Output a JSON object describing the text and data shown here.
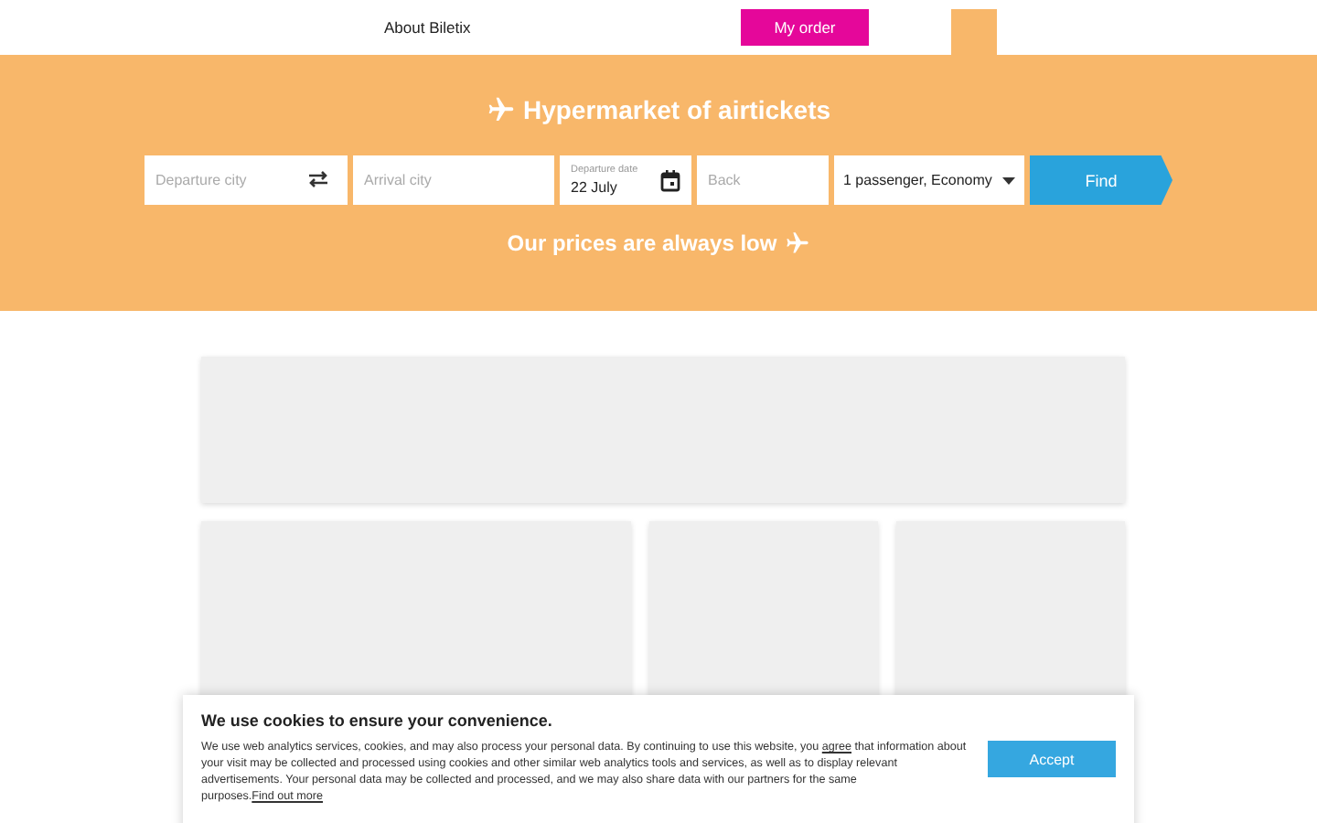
{
  "header": {
    "nav_link": "About Biletix",
    "order_button": "My order"
  },
  "hero": {
    "title": "Hypermarket of airtickets",
    "subtitle": "Our prices are always low"
  },
  "search": {
    "departure": {
      "placeholder": "Departure city"
    },
    "arrival": {
      "placeholder": "Arrival city"
    },
    "date": {
      "label": "Departure date",
      "value": "22 July"
    },
    "back": {
      "placeholder": "Back"
    },
    "passengers": {
      "value": "1 passenger, Economy"
    },
    "button": "Find"
  },
  "cookie_banner": {
    "title": "We use cookies to ensure your convenience.",
    "text_before": "We use web analytics services, cookies, and may also process your personal data. By continuing to use this website, you ",
    "agree_link": "agree",
    "text_after": " that information about your visit may be collected and processed using cookies and other similar web analytics tools and services, as well as to display relevant advertisements. Your personal data may be collected and processed, and we may also share data with our partners for the same purposes.",
    "more_link": "Find out more",
    "button": "Accept"
  }
}
